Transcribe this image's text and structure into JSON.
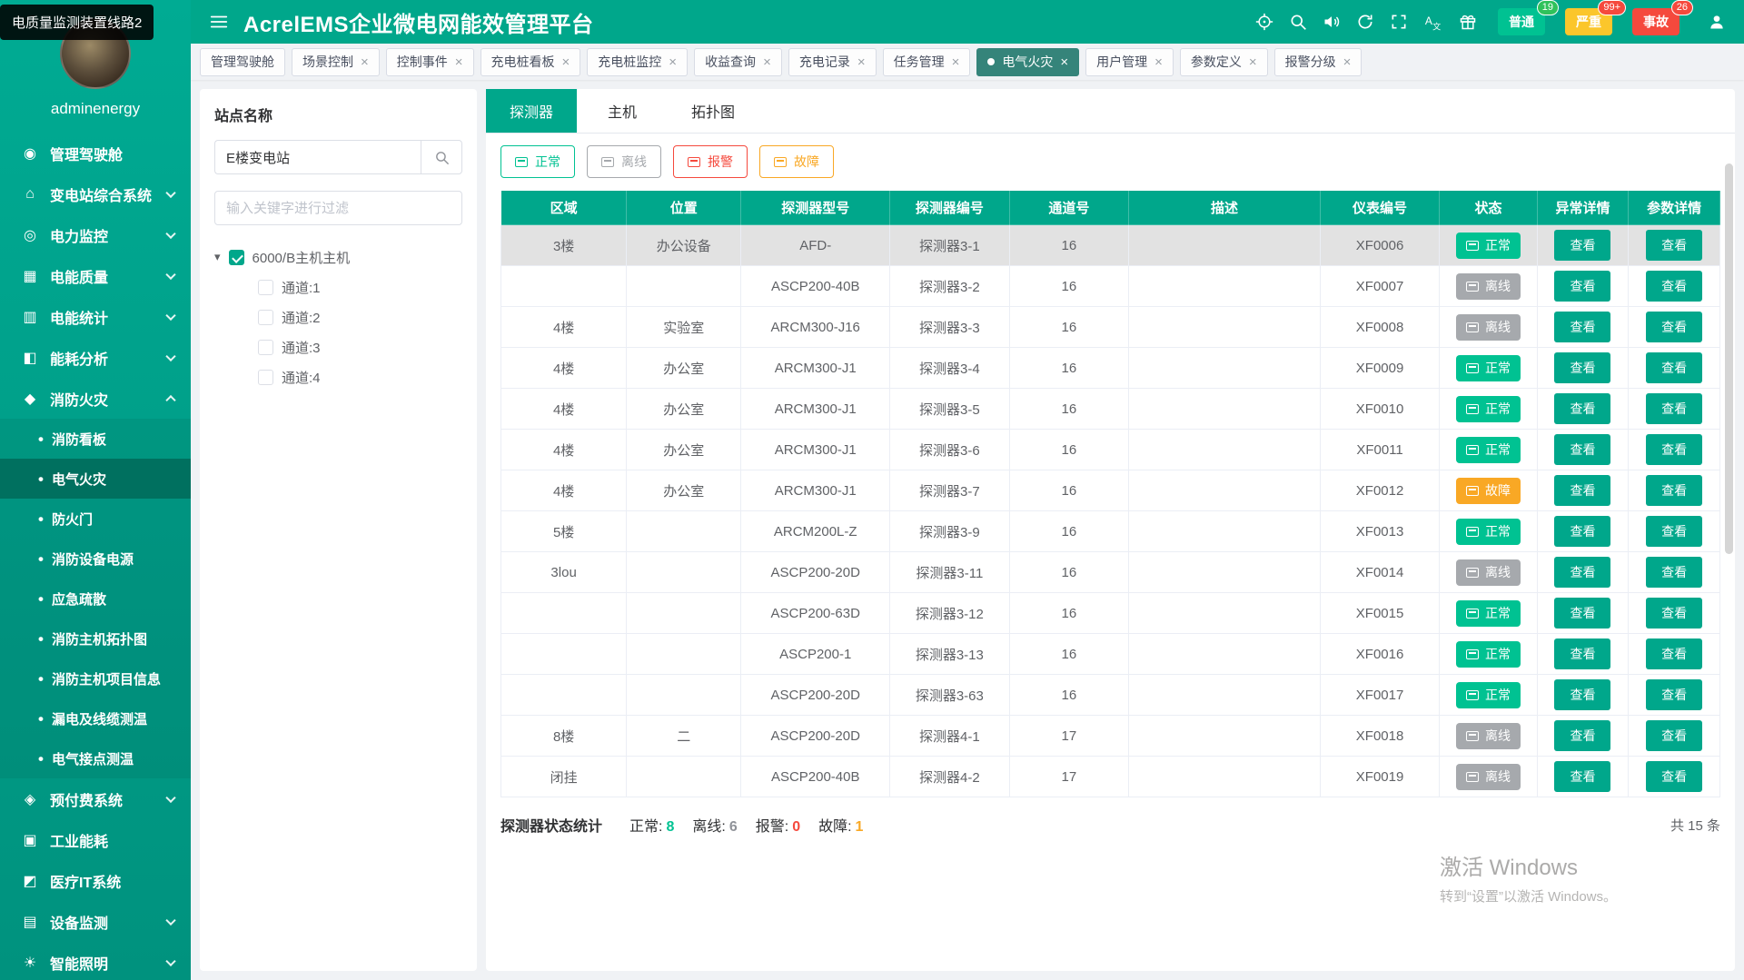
{
  "colors": {
    "primary": "#00a78b",
    "normal": "#00c292",
    "offline": "#a6a9ad",
    "alarm": "#f5493d",
    "fault": "#f9a825"
  },
  "tooltip": {
    "text": "电质量监测装置线路2"
  },
  "topbar": {
    "title": "AcrelEMS企业微电网能效管理平台",
    "alarm_badges": [
      {
        "key": "general",
        "label": "普通",
        "count": "19",
        "bg": "#00c292",
        "bubble": "#2fc25b"
      },
      {
        "key": "severe",
        "label": "严重",
        "count": "99+",
        "bg": "#fbc62b",
        "bubble": "#f5493d"
      },
      {
        "key": "accident",
        "label": "事故",
        "count": "26",
        "bg": "#f5493d",
        "bubble": "#f5493d"
      }
    ]
  },
  "sidebar": {
    "username": "adminenergy",
    "items": [
      {
        "label": "管理驾驶舱",
        "icon": "dashboard-icon",
        "glyph": "◉"
      },
      {
        "label": "变电站综合系统",
        "icon": "substation-icon",
        "glyph": "⌂",
        "chevron": true
      },
      {
        "label": "电力监控",
        "icon": "power-monitor-icon",
        "glyph": "◎",
        "chevron": true
      },
      {
        "label": "电能质量",
        "icon": "power-quality-icon",
        "glyph": "▦",
        "chevron": true
      },
      {
        "label": "电能统计",
        "icon": "power-stats-icon",
        "glyph": "▥",
        "chevron": true
      },
      {
        "label": "能耗分析",
        "icon": "energy-analysis-icon",
        "glyph": "◧",
        "chevron": true
      },
      {
        "label": "消防火灾",
        "icon": "fire-icon",
        "glyph": "◆",
        "chevron": true,
        "expanded": true,
        "children": [
          {
            "label": "消防看板"
          },
          {
            "label": "电气火灾",
            "active": true
          },
          {
            "label": "防火门"
          },
          {
            "label": "消防设备电源"
          },
          {
            "label": "应急疏散"
          },
          {
            "label": "消防主机拓扑图"
          },
          {
            "label": "消防主机项目信息"
          },
          {
            "label": "漏电及线缆测温"
          },
          {
            "label": "电气接点测温"
          }
        ]
      },
      {
        "label": "预付费系统",
        "icon": "prepaid-icon",
        "glyph": "◈",
        "chevron": true
      },
      {
        "label": "工业能耗",
        "icon": "industry-icon",
        "glyph": "▣"
      },
      {
        "label": "医疗IT系统",
        "icon": "medical-icon",
        "glyph": "◩"
      },
      {
        "label": "设备监测",
        "icon": "device-monitor-icon",
        "glyph": "▤",
        "chevron": true
      },
      {
        "label": "智能照明",
        "icon": "lighting-icon",
        "glyph": "☀",
        "chevron": true
      }
    ]
  },
  "tabbar": {
    "tabs": [
      {
        "label": "管理驾驶舱"
      },
      {
        "label": "场景控制",
        "closable": true
      },
      {
        "label": "控制事件",
        "closable": true
      },
      {
        "label": "充电桩看板",
        "closable": true
      },
      {
        "label": "充电桩监控",
        "closable": true
      },
      {
        "label": "收益查询",
        "closable": true
      },
      {
        "label": "充电记录",
        "closable": true
      },
      {
        "label": "任务管理",
        "closable": true
      },
      {
        "label": "电气火灾",
        "closable": true,
        "active": true
      },
      {
        "label": "用户管理",
        "closable": true
      },
      {
        "label": "参数定义",
        "closable": true
      },
      {
        "label": "报警分级",
        "closable": true
      }
    ]
  },
  "site_panel": {
    "title": "站点名称",
    "search_value": "E楼变电站",
    "filter_placeholder": "输入关键字进行过滤",
    "tree": {
      "root": {
        "label": "6000/B主机主机",
        "checked": true
      },
      "children": [
        {
          "label": "通道:1"
        },
        {
          "label": "通道:2"
        },
        {
          "label": "通道:3"
        },
        {
          "label": "通道:4"
        }
      ]
    }
  },
  "main": {
    "tabs": [
      {
        "label": "探测器",
        "active": true
      },
      {
        "label": "主机"
      },
      {
        "label": "拓扑图"
      }
    ],
    "statuses": {
      "normal": {
        "label": "正常",
        "bg": "#00c292"
      },
      "offline": {
        "label": "离线",
        "bg": "#a6a9ad"
      },
      "alarm": {
        "label": "报警",
        "bg": "#f5493d"
      },
      "fault": {
        "label": "故障",
        "bg": "#f9a825"
      }
    },
    "filters": [
      "normal",
      "offline",
      "alarm",
      "fault"
    ],
    "table": {
      "columns": [
        "区域",
        "位置",
        "探测器型号",
        "探测器编号",
        "通道号",
        "描述",
        "仪表编号",
        "状态",
        "异常详情",
        "参数详情"
      ],
      "view_label": "查看",
      "rows": [
        {
          "area": "3楼",
          "location": "办公设备",
          "model": "AFD-",
          "detector": "探测器3-1",
          "channel": "16",
          "desc": "",
          "meter": "XF0006",
          "status": "normal",
          "selected": true
        },
        {
          "area": "",
          "location": "",
          "model": "ASCP200-40B",
          "detector": "探测器3-2",
          "channel": "16",
          "desc": "",
          "meter": "XF0007",
          "status": "offline"
        },
        {
          "area": "4楼",
          "location": "实验室",
          "model": "ARCM300-J16",
          "detector": "探测器3-3",
          "channel": "16",
          "desc": "",
          "meter": "XF0008",
          "status": "offline"
        },
        {
          "area": "4楼",
          "location": "办公室",
          "model": "ARCM300-J1",
          "detector": "探测器3-4",
          "channel": "16",
          "desc": "",
          "meter": "XF0009",
          "status": "normal"
        },
        {
          "area": "4楼",
          "location": "办公室",
          "model": "ARCM300-J1",
          "detector": "探测器3-5",
          "channel": "16",
          "desc": "",
          "meter": "XF0010",
          "status": "normal"
        },
        {
          "area": "4楼",
          "location": "办公室",
          "model": "ARCM300-J1",
          "detector": "探测器3-6",
          "channel": "16",
          "desc": "",
          "meter": "XF0011",
          "status": "normal"
        },
        {
          "area": "4楼",
          "location": "办公室",
          "model": "ARCM300-J1",
          "detector": "探测器3-7",
          "channel": "16",
          "desc": "",
          "meter": "XF0012",
          "status": "fault"
        },
        {
          "area": "5楼",
          "location": "",
          "model": "ARCM200L-Z",
          "detector": "探测器3-9",
          "channel": "16",
          "desc": "",
          "meter": "XF0013",
          "status": "normal"
        },
        {
          "area": "3lou",
          "location": "",
          "model": "ASCP200-20D",
          "detector": "探测器3-11",
          "channel": "16",
          "desc": "",
          "meter": "XF0014",
          "status": "offline"
        },
        {
          "area": "",
          "location": "",
          "model": "ASCP200-63D",
          "detector": "探测器3-12",
          "channel": "16",
          "desc": "",
          "meter": "XF0015",
          "status": "normal"
        },
        {
          "area": "",
          "location": "",
          "model": "ASCP200-1",
          "detector": "探测器3-13",
          "channel": "16",
          "desc": "",
          "meter": "XF0016",
          "status": "normal"
        },
        {
          "area": "",
          "location": "",
          "model": "ASCP200-20D",
          "detector": "探测器3-63",
          "channel": "16",
          "desc": "",
          "meter": "XF0017",
          "status": "normal"
        },
        {
          "area": "8楼",
          "location": "二",
          "model": "ASCP200-20D",
          "detector": "探测器4-1",
          "channel": "17",
          "desc": "",
          "meter": "XF0018",
          "status": "offline"
        },
        {
          "area": "闭挂",
          "location": "",
          "model": "ASCP200-40B",
          "detector": "探测器4-2",
          "channel": "17",
          "desc": "",
          "meter": "XF0019",
          "status": "offline"
        }
      ]
    },
    "footer": {
      "stats_label": "探测器状态统计",
      "stats": [
        {
          "label": "正常:",
          "value": "8",
          "color": "#00c292"
        },
        {
          "label": "离线:",
          "value": "6",
          "color": "#909399"
        },
        {
          "label": "报警:",
          "value": "0",
          "color": "#f5493d"
        },
        {
          "label": "故障:",
          "value": "1",
          "color": "#f9a825"
        }
      ],
      "total": "共 15 条"
    }
  },
  "watermark": {
    "line1": "激活 Windows",
    "line2": "转到“设置”以激活 Windows。"
  }
}
